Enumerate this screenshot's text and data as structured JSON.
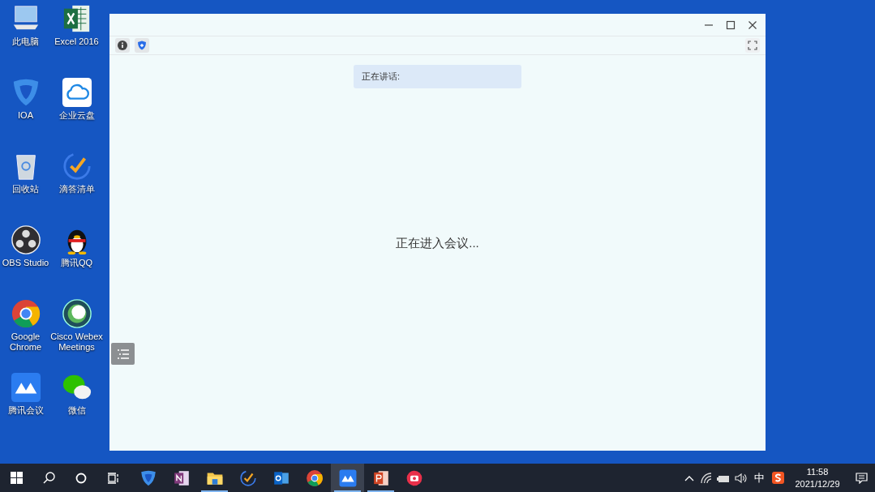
{
  "desktop_icons": [
    {
      "kind": "pc",
      "label": "此电脑"
    },
    {
      "kind": "excel",
      "label": "Excel 2016"
    },
    {
      "kind": "ioa",
      "label": "IOA"
    },
    {
      "kind": "cloud",
      "label": "企业云盘"
    },
    {
      "kind": "bin",
      "label": "回收站"
    },
    {
      "kind": "tick",
      "label": "滴答清单"
    },
    {
      "kind": "obs",
      "label": "OBS Studio"
    },
    {
      "kind": "qq",
      "label": "腾讯QQ"
    },
    {
      "kind": "chrome",
      "label": "Google Chrome"
    },
    {
      "kind": "webex",
      "label": "Cisco Webex Meetings"
    },
    {
      "kind": "meeting",
      "label": "腾讯会议"
    },
    {
      "kind": "wechat",
      "label": "微信"
    }
  ],
  "window": {
    "speaking_label": "正在讲话:",
    "status": "正在进入会议..."
  },
  "taskbar": {
    "apps": [
      {
        "kind": "ioa",
        "running": false,
        "selected": false
      },
      {
        "kind": "onenote",
        "running": false,
        "selected": false
      },
      {
        "kind": "explorer",
        "running": true,
        "selected": false
      },
      {
        "kind": "tick",
        "running": false,
        "selected": false
      },
      {
        "kind": "outlook",
        "running": false,
        "selected": false
      },
      {
        "kind": "chrome",
        "running": false,
        "selected": false
      },
      {
        "kind": "meeting",
        "running": true,
        "selected": true
      },
      {
        "kind": "powerpoint",
        "running": true,
        "selected": false
      },
      {
        "kind": "recorder",
        "running": false,
        "selected": false
      }
    ],
    "ime": "中",
    "time": "11:58",
    "date": "2021/12/29"
  }
}
